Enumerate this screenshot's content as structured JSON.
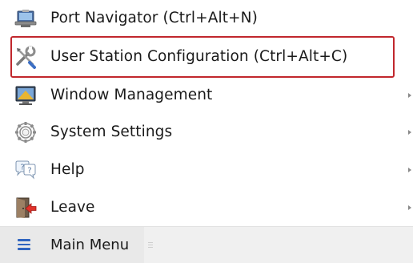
{
  "menu": {
    "items": [
      {
        "label": "Port Navigator (Ctrl+Alt+N)",
        "icon": "monitor-icon",
        "has_submenu": false
      },
      {
        "label": "User Station Configuration (Ctrl+Alt+C)",
        "icon": "tools-icon",
        "has_submenu": false,
        "highlighted": true
      },
      {
        "label": "Window Management",
        "icon": "window-icon",
        "has_submenu": true
      },
      {
        "label": "System Settings",
        "icon": "gear-icon",
        "has_submenu": true
      },
      {
        "label": "Help",
        "icon": "help-icon",
        "has_submenu": true
      },
      {
        "label": "Leave",
        "icon": "exit-icon",
        "has_submenu": true
      }
    ]
  },
  "bottom_bar": {
    "main_menu_label": "Main Menu",
    "icon": "hamburger-icon"
  },
  "colors": {
    "highlight_border": "#c1272d",
    "hamburger": "#2f64c0",
    "bottom_bar_bg": "#f0f0f0"
  }
}
